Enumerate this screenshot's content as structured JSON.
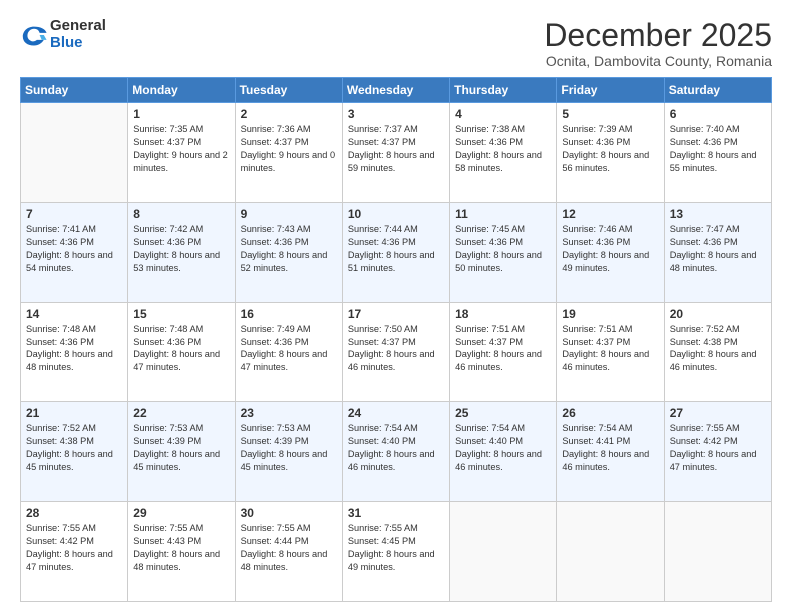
{
  "logo": {
    "general": "General",
    "blue": "Blue"
  },
  "header": {
    "month": "December 2025",
    "location": "Ocnita, Dambovita County, Romania"
  },
  "weekdays": [
    "Sunday",
    "Monday",
    "Tuesday",
    "Wednesday",
    "Thursday",
    "Friday",
    "Saturday"
  ],
  "weeks": [
    [
      {
        "day": "",
        "sunrise": "",
        "sunset": "",
        "daylight": "",
        "empty": true
      },
      {
        "day": "1",
        "sunrise": "Sunrise: 7:35 AM",
        "sunset": "Sunset: 4:37 PM",
        "daylight": "Daylight: 9 hours and 2 minutes."
      },
      {
        "day": "2",
        "sunrise": "Sunrise: 7:36 AM",
        "sunset": "Sunset: 4:37 PM",
        "daylight": "Daylight: 9 hours and 0 minutes."
      },
      {
        "day": "3",
        "sunrise": "Sunrise: 7:37 AM",
        "sunset": "Sunset: 4:37 PM",
        "daylight": "Daylight: 8 hours and 59 minutes."
      },
      {
        "day": "4",
        "sunrise": "Sunrise: 7:38 AM",
        "sunset": "Sunset: 4:36 PM",
        "daylight": "Daylight: 8 hours and 58 minutes."
      },
      {
        "day": "5",
        "sunrise": "Sunrise: 7:39 AM",
        "sunset": "Sunset: 4:36 PM",
        "daylight": "Daylight: 8 hours and 56 minutes."
      },
      {
        "day": "6",
        "sunrise": "Sunrise: 7:40 AM",
        "sunset": "Sunset: 4:36 PM",
        "daylight": "Daylight: 8 hours and 55 minutes."
      }
    ],
    [
      {
        "day": "7",
        "sunrise": "Sunrise: 7:41 AM",
        "sunset": "Sunset: 4:36 PM",
        "daylight": "Daylight: 8 hours and 54 minutes."
      },
      {
        "day": "8",
        "sunrise": "Sunrise: 7:42 AM",
        "sunset": "Sunset: 4:36 PM",
        "daylight": "Daylight: 8 hours and 53 minutes."
      },
      {
        "day": "9",
        "sunrise": "Sunrise: 7:43 AM",
        "sunset": "Sunset: 4:36 PM",
        "daylight": "Daylight: 8 hours and 52 minutes."
      },
      {
        "day": "10",
        "sunrise": "Sunrise: 7:44 AM",
        "sunset": "Sunset: 4:36 PM",
        "daylight": "Daylight: 8 hours and 51 minutes."
      },
      {
        "day": "11",
        "sunrise": "Sunrise: 7:45 AM",
        "sunset": "Sunset: 4:36 PM",
        "daylight": "Daylight: 8 hours and 50 minutes."
      },
      {
        "day": "12",
        "sunrise": "Sunrise: 7:46 AM",
        "sunset": "Sunset: 4:36 PM",
        "daylight": "Daylight: 8 hours and 49 minutes."
      },
      {
        "day": "13",
        "sunrise": "Sunrise: 7:47 AM",
        "sunset": "Sunset: 4:36 PM",
        "daylight": "Daylight: 8 hours and 48 minutes."
      }
    ],
    [
      {
        "day": "14",
        "sunrise": "Sunrise: 7:48 AM",
        "sunset": "Sunset: 4:36 PM",
        "daylight": "Daylight: 8 hours and 48 minutes."
      },
      {
        "day": "15",
        "sunrise": "Sunrise: 7:48 AM",
        "sunset": "Sunset: 4:36 PM",
        "daylight": "Daylight: 8 hours and 47 minutes."
      },
      {
        "day": "16",
        "sunrise": "Sunrise: 7:49 AM",
        "sunset": "Sunset: 4:36 PM",
        "daylight": "Daylight: 8 hours and 47 minutes."
      },
      {
        "day": "17",
        "sunrise": "Sunrise: 7:50 AM",
        "sunset": "Sunset: 4:37 PM",
        "daylight": "Daylight: 8 hours and 46 minutes."
      },
      {
        "day": "18",
        "sunrise": "Sunrise: 7:51 AM",
        "sunset": "Sunset: 4:37 PM",
        "daylight": "Daylight: 8 hours and 46 minutes."
      },
      {
        "day": "19",
        "sunrise": "Sunrise: 7:51 AM",
        "sunset": "Sunset: 4:37 PM",
        "daylight": "Daylight: 8 hours and 46 minutes."
      },
      {
        "day": "20",
        "sunrise": "Sunrise: 7:52 AM",
        "sunset": "Sunset: 4:38 PM",
        "daylight": "Daylight: 8 hours and 46 minutes."
      }
    ],
    [
      {
        "day": "21",
        "sunrise": "Sunrise: 7:52 AM",
        "sunset": "Sunset: 4:38 PM",
        "daylight": "Daylight: 8 hours and 45 minutes."
      },
      {
        "day": "22",
        "sunrise": "Sunrise: 7:53 AM",
        "sunset": "Sunset: 4:39 PM",
        "daylight": "Daylight: 8 hours and 45 minutes."
      },
      {
        "day": "23",
        "sunrise": "Sunrise: 7:53 AM",
        "sunset": "Sunset: 4:39 PM",
        "daylight": "Daylight: 8 hours and 45 minutes."
      },
      {
        "day": "24",
        "sunrise": "Sunrise: 7:54 AM",
        "sunset": "Sunset: 4:40 PM",
        "daylight": "Daylight: 8 hours and 46 minutes."
      },
      {
        "day": "25",
        "sunrise": "Sunrise: 7:54 AM",
        "sunset": "Sunset: 4:40 PM",
        "daylight": "Daylight: 8 hours and 46 minutes."
      },
      {
        "day": "26",
        "sunrise": "Sunrise: 7:54 AM",
        "sunset": "Sunset: 4:41 PM",
        "daylight": "Daylight: 8 hours and 46 minutes."
      },
      {
        "day": "27",
        "sunrise": "Sunrise: 7:55 AM",
        "sunset": "Sunset: 4:42 PM",
        "daylight": "Daylight: 8 hours and 47 minutes."
      }
    ],
    [
      {
        "day": "28",
        "sunrise": "Sunrise: 7:55 AM",
        "sunset": "Sunset: 4:42 PM",
        "daylight": "Daylight: 8 hours and 47 minutes."
      },
      {
        "day": "29",
        "sunrise": "Sunrise: 7:55 AM",
        "sunset": "Sunset: 4:43 PM",
        "daylight": "Daylight: 8 hours and 48 minutes."
      },
      {
        "day": "30",
        "sunrise": "Sunrise: 7:55 AM",
        "sunset": "Sunset: 4:44 PM",
        "daylight": "Daylight: 8 hours and 48 minutes."
      },
      {
        "day": "31",
        "sunrise": "Sunrise: 7:55 AM",
        "sunset": "Sunset: 4:45 PM",
        "daylight": "Daylight: 8 hours and 49 minutes."
      },
      {
        "day": "",
        "empty": true
      },
      {
        "day": "",
        "empty": true
      },
      {
        "day": "",
        "empty": true
      }
    ]
  ]
}
